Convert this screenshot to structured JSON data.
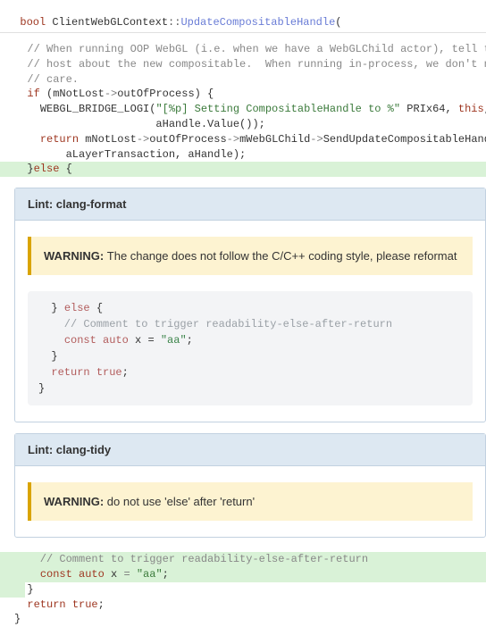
{
  "header": {
    "ret": "bool ",
    "cls": "ClientWebGLContext",
    "scope": "::",
    "fn": "UpdateCompositableHandle",
    "open": "("
  },
  "code": {
    "c1": "  // When running OOP WebGL (i.e. when we have a WebGLChild actor), tell the",
    "c2": "  // host about the new compositable.  When running in-process, we don't need to",
    "c3": "  // care.",
    "if_kw": "  if ",
    "if_cond": "(mNotLost",
    "arrow1": "->",
    "oop": "outOfProcess) {",
    "log_indent": "    ",
    "log_macro": "WEBGL_BRIDGE_LOGI",
    "log_open": "(",
    "log_str": "\"[%p] Setting CompositableHandle to %\"",
    "log_after": " PRIx64, ",
    "this_kw": "this",
    "log_tail": ",",
    "log_line2": "                      aHandle.Value());",
    "ret_indent": "    ",
    "ret_kw": "return",
    "ret_body": " mNotLost",
    "arrow2": "->",
    "oop2": "outOfProcess",
    "arrow3": "->",
    "child": "mWebGLChild",
    "arrow4": "->",
    "send": "SendUpdateCompositableHandle(",
    "send_line2": "        aLayerTransaction, aHandle);",
    "close_if": "  }",
    "else_kw": "else",
    "else_brace": " {",
    "added_cmt": "    // Comment to trigger readability-else-after-return",
    "added_const": "    ",
    "const_kw": "const",
    "added_auto": " ",
    "auto_kw": "auto",
    "added_var": " x ",
    "eq": "=",
    "sp": " ",
    "xval": "\"aa\"",
    "semi": ";",
    "close_else": "  }",
    "ret2_indent": "  ",
    "ret2_kw": "return",
    "ret2_sp": " ",
    "true_kw": "true",
    "semi2": ";",
    "close_fn": "}"
  },
  "lint1": {
    "title": "Lint: clang-format",
    "warn_label": "WARNING: ",
    "warn_msg": "The change does not follow the C/C++ coding style, please reformat",
    "snippet": {
      "l1": "  } ",
      "l1_else": "else",
      "l1_tail": " {",
      "l2": "    // Comment to trigger readability-else-after-return",
      "l3_indent": "    ",
      "l3_const": "const",
      "l3_sp1": " ",
      "l3_auto": "auto",
      "l3_sp2": " x = ",
      "l3_val": "\"aa\"",
      "l3_tail": ";",
      "l4": "  }",
      "l5_indent": "  ",
      "l5_ret": "return",
      "l5_sp": " ",
      "l5_true": "true",
      "l5_tail": ";",
      "l6": "}"
    }
  },
  "lint2": {
    "title": "Lint: clang-tidy",
    "warn_label": "WARNING: ",
    "warn_msg": "do not use 'else' after 'return'"
  }
}
